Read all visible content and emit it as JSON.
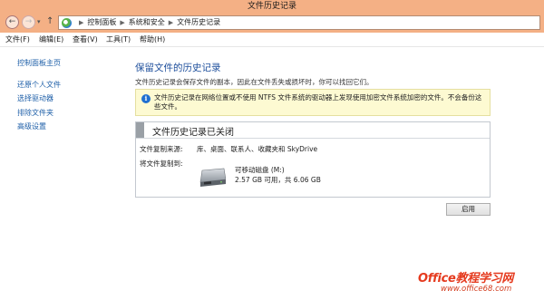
{
  "window": {
    "title": "文件历史记录"
  },
  "address": {
    "crumbs": [
      "控制面板",
      "系统和安全",
      "文件历史记录"
    ]
  },
  "menu": [
    {
      "label": "文件(F)"
    },
    {
      "label": "编辑(E)"
    },
    {
      "label": "查看(V)"
    },
    {
      "label": "工具(T)"
    },
    {
      "label": "帮助(H)"
    }
  ],
  "sidebar": {
    "home": "控制面板主页",
    "items": [
      "还原个人文件",
      "选择驱动器",
      "排除文件夹",
      "高级设置"
    ]
  },
  "main": {
    "heading": "保留文件的历史记录",
    "subtext": "文件历史记录会保存文件的副本，因此在文件丢失或损坏时，你可以找回它们。",
    "info": "文件历史记录在网络位置或不使用 NTFS 文件系统的驱动器上发现使用加密文件系统加密的文件。不会备份这些文件。",
    "status_title": "文件历史记录已关闭",
    "copy_from_label": "文件复制来源:",
    "copy_from_value": "库、桌面、联系人、收藏夹和 SkyDrive",
    "copy_to_label": "将文件复制到:",
    "drive_name": "可移动磁盘 (M:)",
    "drive_space": "2.57 GB 可用，共 6.06 GB",
    "enable_button": "启用"
  },
  "watermark": {
    "line1": "Office教程学习网",
    "line2": "www.office68.com"
  },
  "colors": {
    "titlebar": "#f4b085",
    "link": "#1e5fa8",
    "heading": "#1e4f9c",
    "info_bg": "#fdfad2",
    "watermark": "#e53a1e"
  },
  "icons": [
    "back-arrow-icon",
    "forward-arrow-icon",
    "up-arrow-icon",
    "control-panel-icon",
    "info-icon",
    "removable-drive-icon"
  ]
}
